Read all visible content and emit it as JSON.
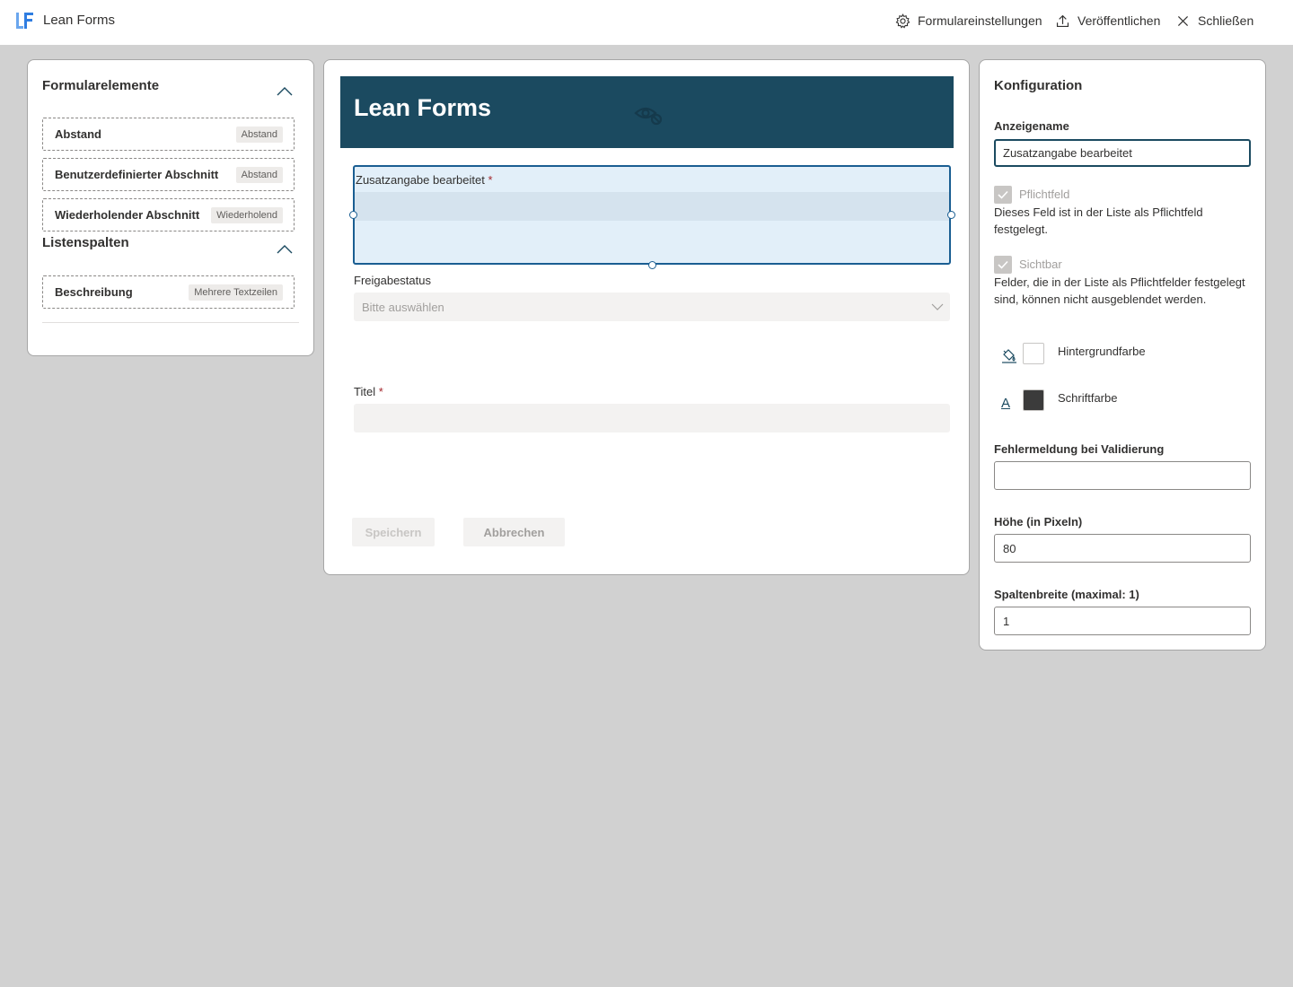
{
  "app": {
    "title": "Lean Forms",
    "logo_text": "LF",
    "brand_color": "#1b4a60",
    "accent_color": "#2f7de1"
  },
  "topbar": {
    "actions": [
      {
        "label": "Formulareinstellungen",
        "icon": "gear-icon"
      },
      {
        "label": "Veröffentlichen",
        "icon": "upload-icon"
      },
      {
        "label": "Schließen",
        "icon": "close-icon"
      }
    ]
  },
  "left_panel": {
    "sections": [
      {
        "title": "Formularelemente",
        "items": [
          {
            "name": "Abstand",
            "badge": "Abstand"
          },
          {
            "name": "Benutzerdefinierter Abschnitt",
            "badge": "Abstand"
          },
          {
            "name": "Wiederholender Abschnitt",
            "badge": "Wiederholend"
          }
        ]
      },
      {
        "title": "Listenspalten",
        "items": [
          {
            "name": "Beschreibung",
            "badge": "Mehrere Textzeilen"
          }
        ]
      }
    ]
  },
  "form": {
    "header_title": "Lean Forms",
    "header_color": "#1b4a60",
    "fields": [
      {
        "label": "Zusatzangabe bearbeitet",
        "required": "*",
        "selected": true
      },
      {
        "label": "Freigabestatus",
        "placeholder": "Bitte auswählen",
        "type": "dropdown"
      },
      {
        "label": "Titel",
        "required": "*",
        "type": "text"
      }
    ],
    "buttons": {
      "save": "Speichern",
      "cancel": "Abbrechen"
    }
  },
  "config": {
    "title": "Konfiguration",
    "display_name_label": "Anzeigename",
    "display_name_value": "Zusatzangabe bearbeitet",
    "required_label": "Pflichtfeld",
    "required_desc": "Dieses Feld ist in der Liste als Pflichtfeld festgelegt.",
    "visible_label": "Sichtbar",
    "visible_desc": "Felder, die in der Liste als Pflichtfelder festgelegt sind, können nicht ausgeblendet werden.",
    "background_color_label": "Hintergrundfarbe",
    "background_color": "#ffffff",
    "font_color_label": "Schriftfarbe",
    "font_color": "#3b3b3b",
    "font_color_glyph": "A",
    "validation_error_label": "Fehlermeldung bei Validierung",
    "validation_error_value": "",
    "height_label": "Höhe (in Pixeln)",
    "height_value": "80",
    "column_width_label": "Spaltenbreite (maximal: 1)",
    "column_width_value": "1"
  }
}
